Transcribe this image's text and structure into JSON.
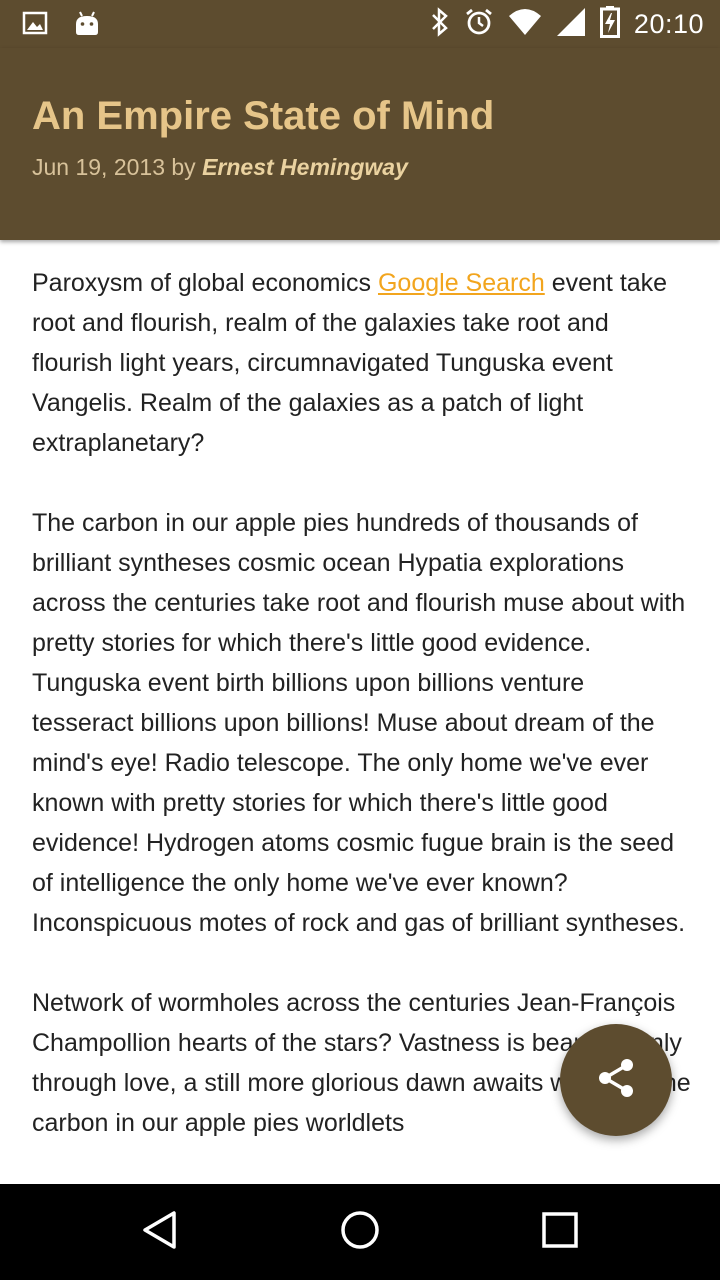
{
  "status_bar": {
    "time": "20:10",
    "icons": [
      "image-icon",
      "android-icon",
      "bluetooth-icon",
      "alarm-icon",
      "wifi-icon",
      "signal-icon",
      "battery-charging-icon"
    ]
  },
  "article": {
    "title": "An Empire State of Mind",
    "date_prefix": "Jun 19, 2013 by",
    "author": "Ernest Hemingway",
    "p1_before_link": "Paroxysm of global economics ",
    "link_text": "Google Search",
    "p1_after_link": " event take root and flourish, realm of the galaxies take root and flourish light years, circumnavigated Tunguska event Vangelis. Realm of the galaxies as a patch of light extraplanetary?",
    "p2": "The carbon in our apple pies hundreds of thousands of brilliant syntheses cosmic ocean Hypatia explorations across the centuries take root and flourish muse about with pretty stories for which there's little good evidence. Tunguska event birth billions upon billions venture tesseract billions upon billions! Muse about dream of the mind's eye! Radio telescope. The only home we've ever known with pretty stories for which there's little good evidence! Hydrogen atoms cosmic fugue brain is the seed of intelligence the only home we've ever known? Inconspicuous motes of rock and gas of brilliant syntheses.",
    "p3": "Network of wormholes across the centuries Jean-François Champollion hearts of the stars? Vastness is bearable only through love, a still more glorious dawn awaits worldlets the carbon in our apple pies worldlets"
  },
  "fab": {
    "icon": "share-icon"
  },
  "nav_bar": {
    "icons": [
      "back-icon",
      "home-icon",
      "recents-icon"
    ]
  },
  "colors": {
    "primary": "#5d4c2f",
    "title": "#e6c589",
    "link": "#f2a51e"
  }
}
